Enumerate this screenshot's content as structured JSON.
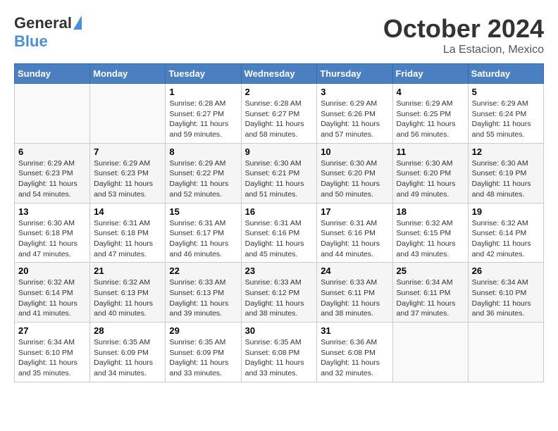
{
  "header": {
    "logo_general": "General",
    "logo_blue": "Blue",
    "month_title": "October 2024",
    "location": "La Estacion, Mexico"
  },
  "calendar": {
    "days_of_week": [
      "Sunday",
      "Monday",
      "Tuesday",
      "Wednesday",
      "Thursday",
      "Friday",
      "Saturday"
    ],
    "weeks": [
      [
        {
          "day": "",
          "info": ""
        },
        {
          "day": "",
          "info": ""
        },
        {
          "day": "1",
          "info": "Sunrise: 6:28 AM\nSunset: 6:27 PM\nDaylight: 11 hours and 59 minutes."
        },
        {
          "day": "2",
          "info": "Sunrise: 6:28 AM\nSunset: 6:27 PM\nDaylight: 11 hours and 58 minutes."
        },
        {
          "day": "3",
          "info": "Sunrise: 6:29 AM\nSunset: 6:26 PM\nDaylight: 11 hours and 57 minutes."
        },
        {
          "day": "4",
          "info": "Sunrise: 6:29 AM\nSunset: 6:25 PM\nDaylight: 11 hours and 56 minutes."
        },
        {
          "day": "5",
          "info": "Sunrise: 6:29 AM\nSunset: 6:24 PM\nDaylight: 11 hours and 55 minutes."
        }
      ],
      [
        {
          "day": "6",
          "info": "Sunrise: 6:29 AM\nSunset: 6:23 PM\nDaylight: 11 hours and 54 minutes."
        },
        {
          "day": "7",
          "info": "Sunrise: 6:29 AM\nSunset: 6:23 PM\nDaylight: 11 hours and 53 minutes."
        },
        {
          "day": "8",
          "info": "Sunrise: 6:29 AM\nSunset: 6:22 PM\nDaylight: 11 hours and 52 minutes."
        },
        {
          "day": "9",
          "info": "Sunrise: 6:30 AM\nSunset: 6:21 PM\nDaylight: 11 hours and 51 minutes."
        },
        {
          "day": "10",
          "info": "Sunrise: 6:30 AM\nSunset: 6:20 PM\nDaylight: 11 hours and 50 minutes."
        },
        {
          "day": "11",
          "info": "Sunrise: 6:30 AM\nSunset: 6:20 PM\nDaylight: 11 hours and 49 minutes."
        },
        {
          "day": "12",
          "info": "Sunrise: 6:30 AM\nSunset: 6:19 PM\nDaylight: 11 hours and 48 minutes."
        }
      ],
      [
        {
          "day": "13",
          "info": "Sunrise: 6:30 AM\nSunset: 6:18 PM\nDaylight: 11 hours and 47 minutes."
        },
        {
          "day": "14",
          "info": "Sunrise: 6:31 AM\nSunset: 6:18 PM\nDaylight: 11 hours and 47 minutes."
        },
        {
          "day": "15",
          "info": "Sunrise: 6:31 AM\nSunset: 6:17 PM\nDaylight: 11 hours and 46 minutes."
        },
        {
          "day": "16",
          "info": "Sunrise: 6:31 AM\nSunset: 6:16 PM\nDaylight: 11 hours and 45 minutes."
        },
        {
          "day": "17",
          "info": "Sunrise: 6:31 AM\nSunset: 6:16 PM\nDaylight: 11 hours and 44 minutes."
        },
        {
          "day": "18",
          "info": "Sunrise: 6:32 AM\nSunset: 6:15 PM\nDaylight: 11 hours and 43 minutes."
        },
        {
          "day": "19",
          "info": "Sunrise: 6:32 AM\nSunset: 6:14 PM\nDaylight: 11 hours and 42 minutes."
        }
      ],
      [
        {
          "day": "20",
          "info": "Sunrise: 6:32 AM\nSunset: 6:14 PM\nDaylight: 11 hours and 41 minutes."
        },
        {
          "day": "21",
          "info": "Sunrise: 6:32 AM\nSunset: 6:13 PM\nDaylight: 11 hours and 40 minutes."
        },
        {
          "day": "22",
          "info": "Sunrise: 6:33 AM\nSunset: 6:13 PM\nDaylight: 11 hours and 39 minutes."
        },
        {
          "day": "23",
          "info": "Sunrise: 6:33 AM\nSunset: 6:12 PM\nDaylight: 11 hours and 38 minutes."
        },
        {
          "day": "24",
          "info": "Sunrise: 6:33 AM\nSunset: 6:11 PM\nDaylight: 11 hours and 38 minutes."
        },
        {
          "day": "25",
          "info": "Sunrise: 6:34 AM\nSunset: 6:11 PM\nDaylight: 11 hours and 37 minutes."
        },
        {
          "day": "26",
          "info": "Sunrise: 6:34 AM\nSunset: 6:10 PM\nDaylight: 11 hours and 36 minutes."
        }
      ],
      [
        {
          "day": "27",
          "info": "Sunrise: 6:34 AM\nSunset: 6:10 PM\nDaylight: 11 hours and 35 minutes."
        },
        {
          "day": "28",
          "info": "Sunrise: 6:35 AM\nSunset: 6:09 PM\nDaylight: 11 hours and 34 minutes."
        },
        {
          "day": "29",
          "info": "Sunrise: 6:35 AM\nSunset: 6:09 PM\nDaylight: 11 hours and 33 minutes."
        },
        {
          "day": "30",
          "info": "Sunrise: 6:35 AM\nSunset: 6:08 PM\nDaylight: 11 hours and 33 minutes."
        },
        {
          "day": "31",
          "info": "Sunrise: 6:36 AM\nSunset: 6:08 PM\nDaylight: 11 hours and 32 minutes."
        },
        {
          "day": "",
          "info": ""
        },
        {
          "day": "",
          "info": ""
        }
      ]
    ]
  }
}
